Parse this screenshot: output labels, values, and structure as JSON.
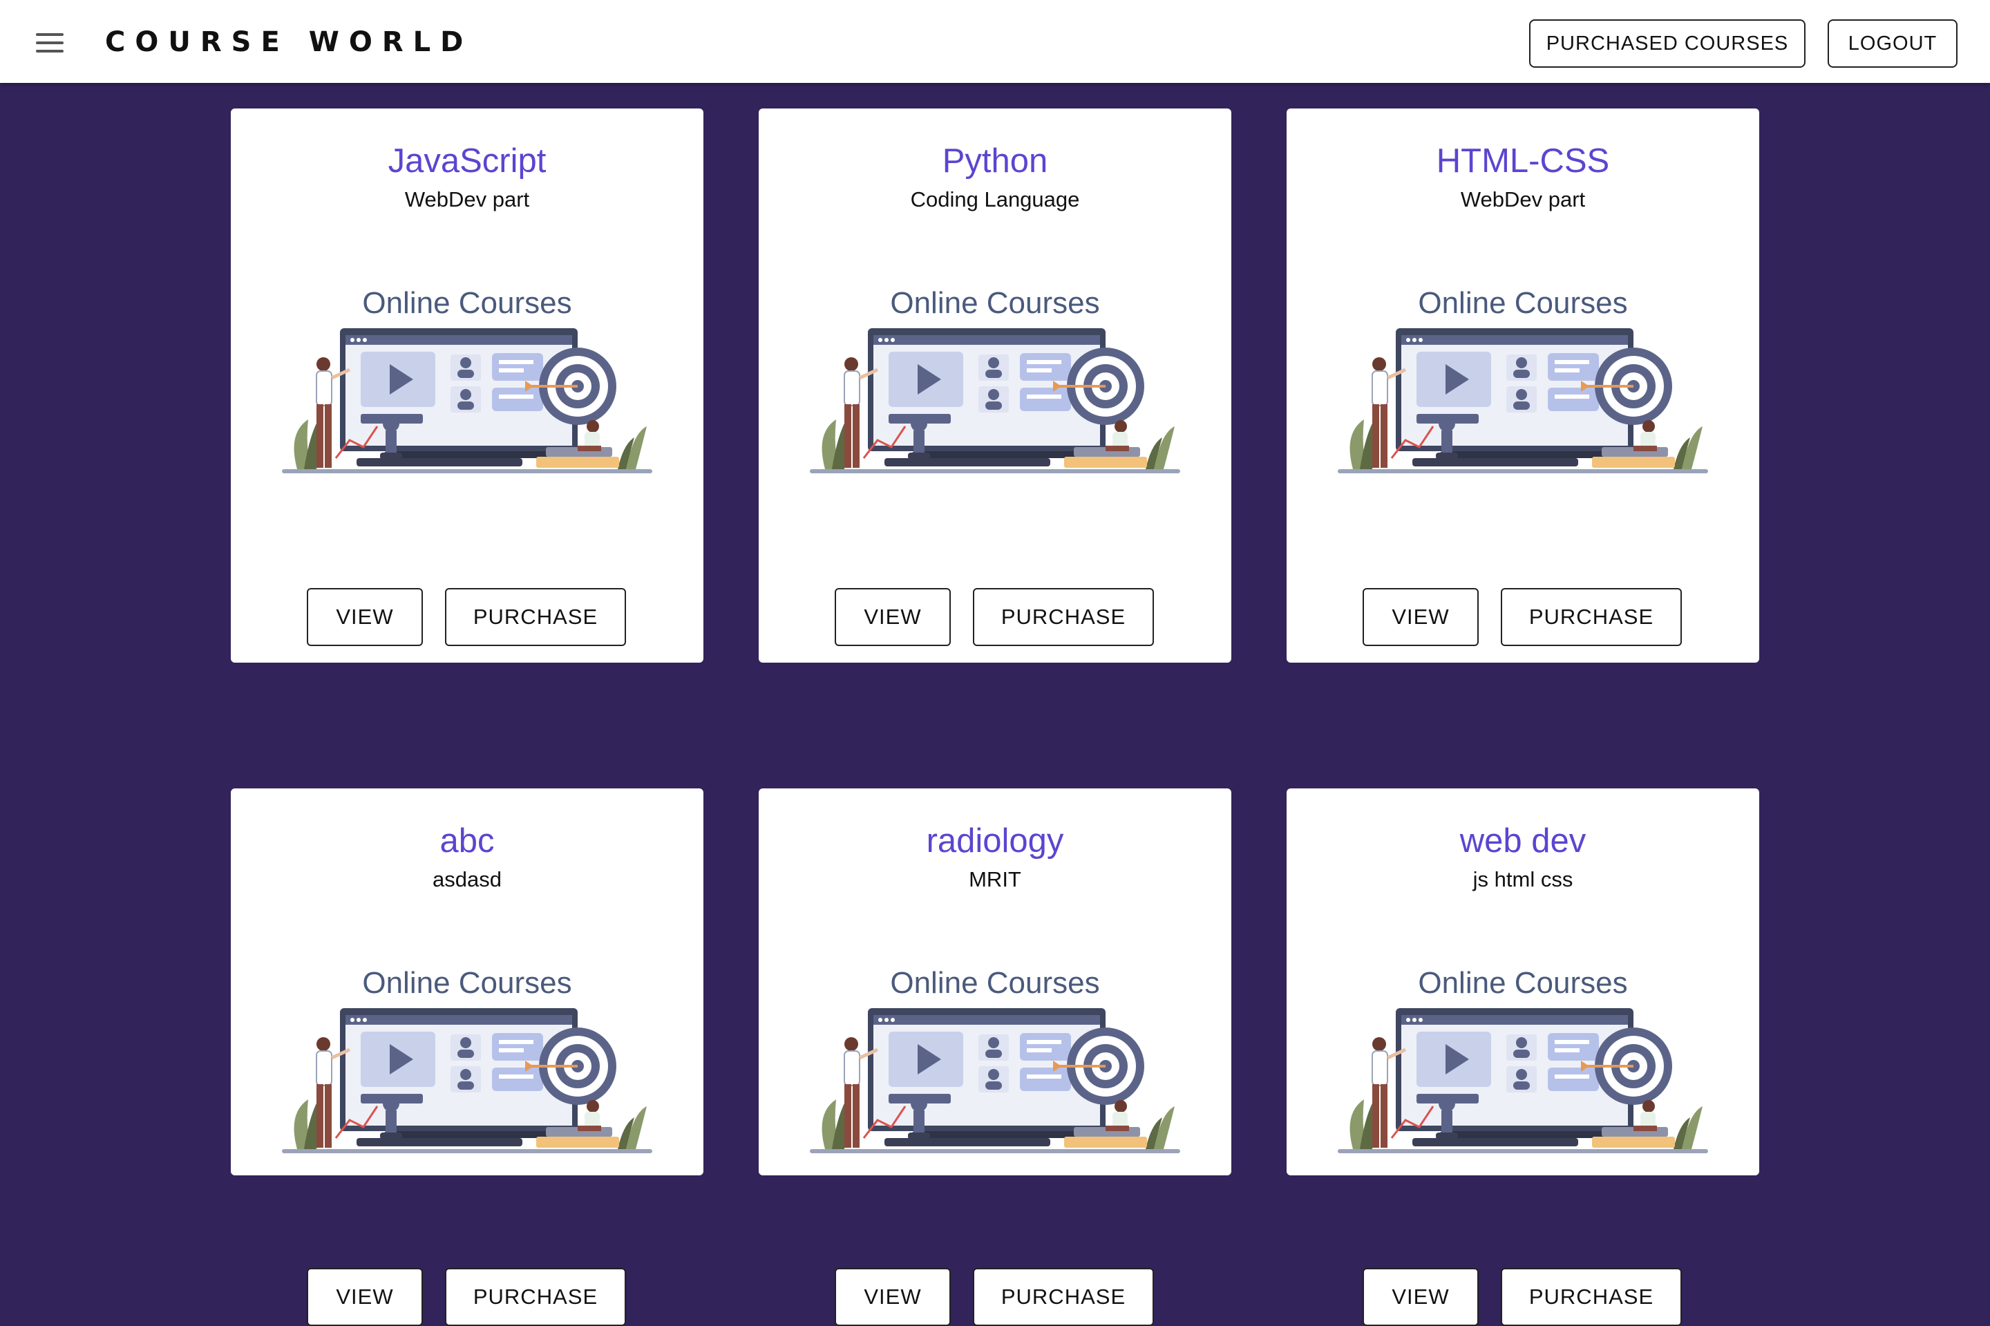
{
  "header": {
    "brand": "COURSE WORLD",
    "purchased_label": "PURCHASED COURSES",
    "logout_label": "LOGOUT"
  },
  "banner_text": "Online Courses",
  "view_label": "VIEW",
  "purchase_label": "PURCHASE",
  "courses": [
    {
      "title": "JavaScript",
      "subtitle": "WebDev part"
    },
    {
      "title": "Python",
      "subtitle": "Coding Language"
    },
    {
      "title": "HTML-CSS",
      "subtitle": "WebDev part"
    },
    {
      "title": "abc",
      "subtitle": "asdasd"
    },
    {
      "title": "radiology",
      "subtitle": "MRIT"
    },
    {
      "title": "web dev",
      "subtitle": "js html css"
    }
  ],
  "colors": {
    "page_bg": "#32235a",
    "title": "#5b45d0",
    "illustration_accent": "#5b6488"
  }
}
